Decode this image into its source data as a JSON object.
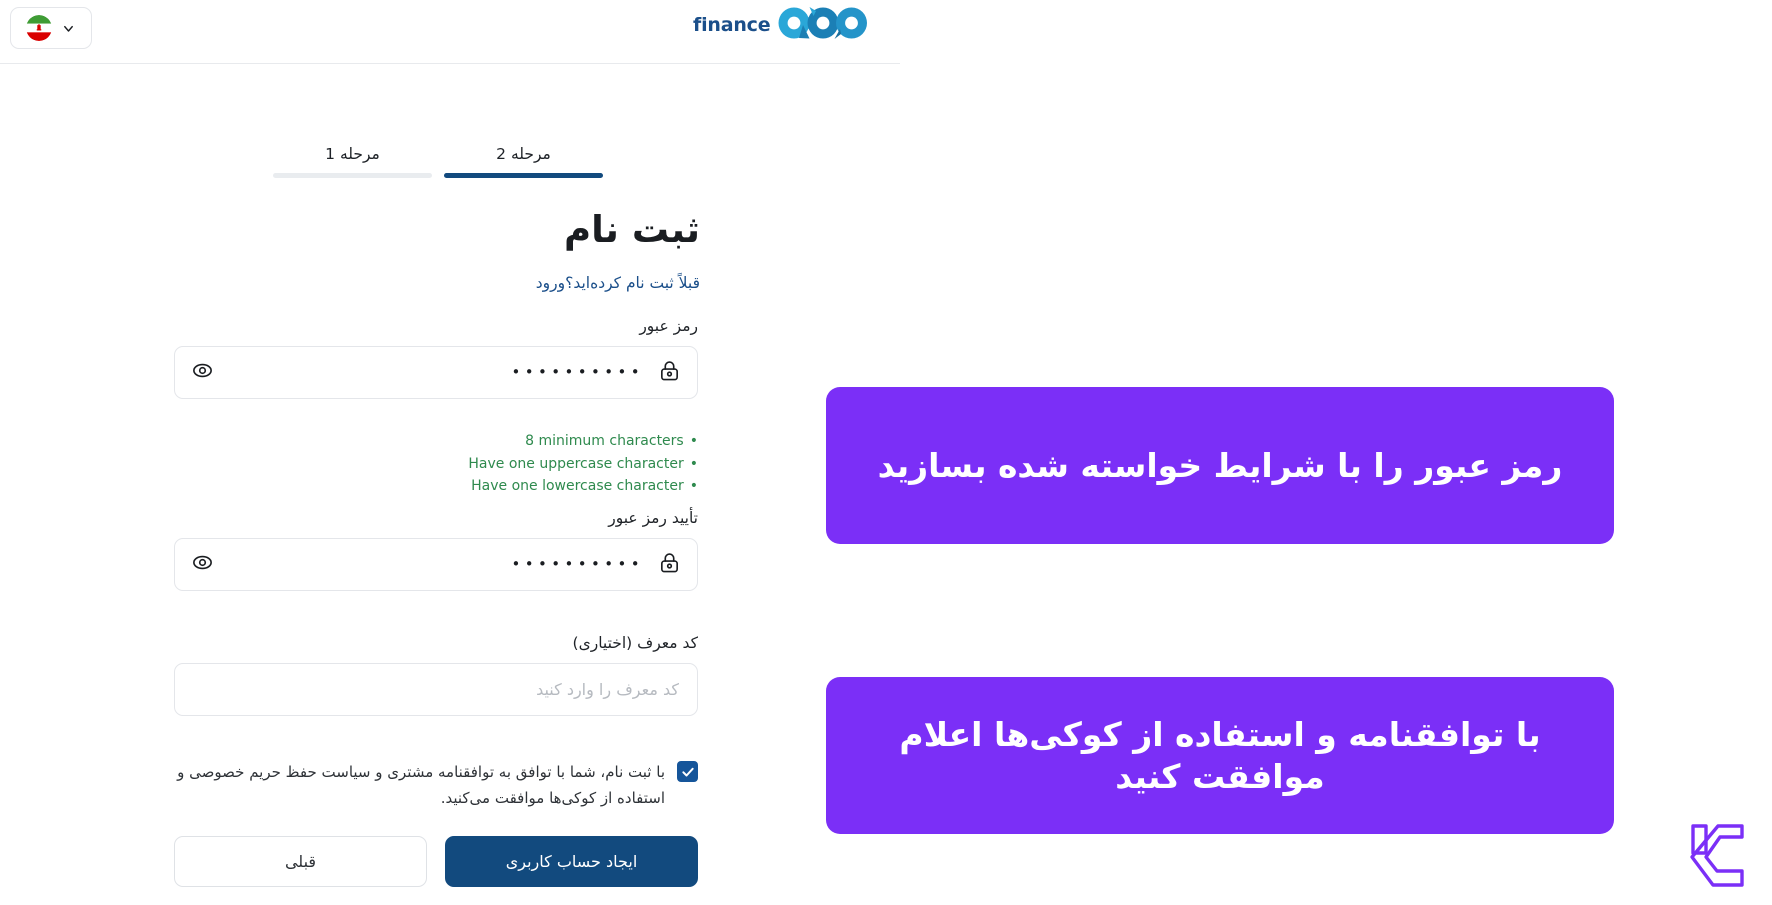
{
  "header": {
    "lang_selector": {
      "icon_chevron": "chevron-down-icon",
      "icon_flag": "iran-flag-icon",
      "value": ""
    },
    "brand": {
      "word": "finance",
      "logo_alt": "apo-logo"
    }
  },
  "steps": [
    {
      "label": "مرحله 2",
      "active": true
    },
    {
      "label": "مرحله 1",
      "active": false
    }
  ],
  "form": {
    "title": "ثبت نام",
    "subtitle_question": "قبلاً ثبت نام کرده‌اید؟",
    "subtitle_link": "ورود",
    "password": {
      "label": "رمز عبور",
      "value_masked": "••••••••••",
      "lock_icon": "lock-icon",
      "eye_icon": "eye-icon"
    },
    "password_rules": [
      "8 minimum characters",
      "Have one uppercase character",
      "Have one lowercase character"
    ],
    "confirm_password": {
      "label": "تأیید رمز عبور",
      "value_masked": "••••••••••",
      "lock_icon": "lock-icon",
      "eye_icon": "eye-icon"
    },
    "referral": {
      "label": "کد معرف (اختیاری)",
      "placeholder": "کد معرف را وارد کنید",
      "value": ""
    },
    "terms": {
      "checked": true,
      "text": "با ثبت نام، شما با توافق به توافقنامه مشتری و سیاست حفظ حریم خصوصی و استفاده از کوکی‌ها موافقت می‌کنید."
    },
    "buttons": {
      "primary": "ایجاد حساب کاربری",
      "secondary": "قبلی"
    }
  },
  "annotations": [
    {
      "id": "callout-password",
      "text": "رمز عبور را با شرایط خواسته شده بسازید"
    },
    {
      "id": "callout-terms",
      "text": "با توافقنامه و استفاده از کوکی‌ها اعلام موافقت کنید"
    }
  ],
  "colors": {
    "brand_navy": "#124a7e",
    "brand_cyan": "#2aa7d8",
    "accent_purple": "#7b2ff7",
    "rule_green": "#2f8a4e",
    "checkbox_blue": "#15559a"
  },
  "watermark": {
    "name": "lc-watermark-logo"
  }
}
